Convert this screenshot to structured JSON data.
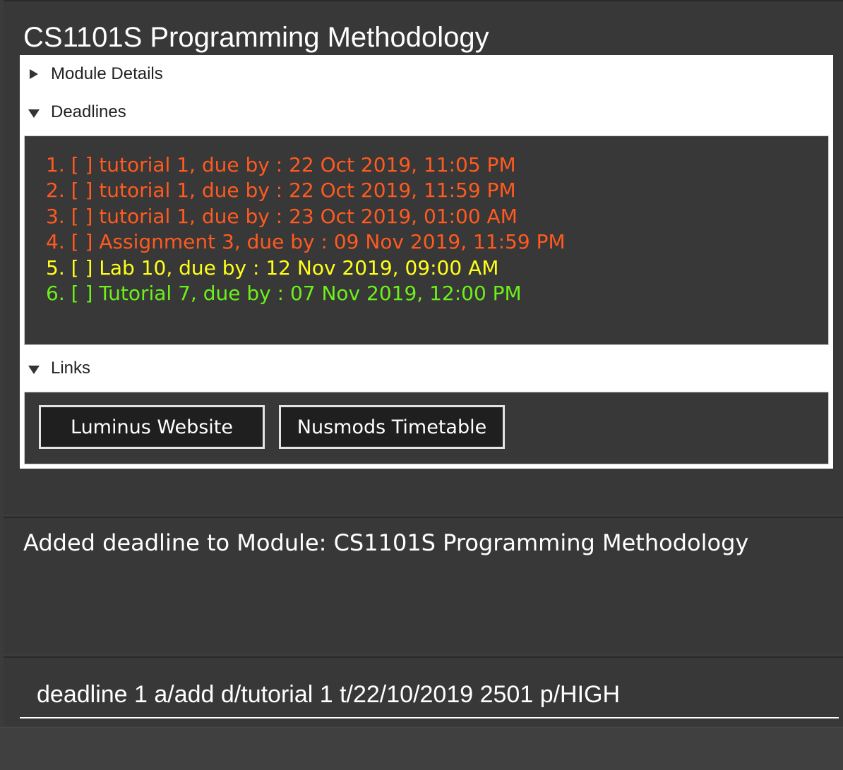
{
  "module": {
    "title": "CS1101S Programming Methodology"
  },
  "sections": {
    "details": {
      "label": "Module Details",
      "expanded": false
    },
    "deadlines": {
      "label": "Deadlines",
      "expanded": true
    },
    "links": {
      "label": "Links",
      "expanded": true
    }
  },
  "deadlines": [
    {
      "text": "1. [ ] tutorial 1, due by : 22 Oct 2019, 11:05 PM",
      "color": "#ff5a1f"
    },
    {
      "text": "2. [ ] tutorial 1, due by : 22 Oct 2019, 11:59 PM",
      "color": "#ff5a1f"
    },
    {
      "text": "3. [ ] tutorial 1, due by : 23 Oct 2019, 01:00 AM",
      "color": "#ff5a1f"
    },
    {
      "text": "4. [ ] Assignment 3, due by : 09 Nov 2019, 11:59 PM",
      "color": "#ff5a1f"
    },
    {
      "text": "5. [ ] Lab 10, due by : 12 Nov 2019, 09:00 AM",
      "color": "#ffff1a"
    },
    {
      "text": "6. [ ] Tutorial 7, due by : 07 Nov 2019, 12:00 PM",
      "color": "#6cf01a"
    }
  ],
  "links": [
    {
      "label": "Luminus Website",
      "name": "luminus-website-button"
    },
    {
      "label": "Nusmods Timetable",
      "name": "nusmods-timetable-button"
    }
  ],
  "result": {
    "message": "Added deadline to Module: CS1101S Programming Methodology"
  },
  "command": {
    "value": "deadline 1 a/add d/tutorial 1 t/22/10/2019 2501 p/HIGH"
  }
}
